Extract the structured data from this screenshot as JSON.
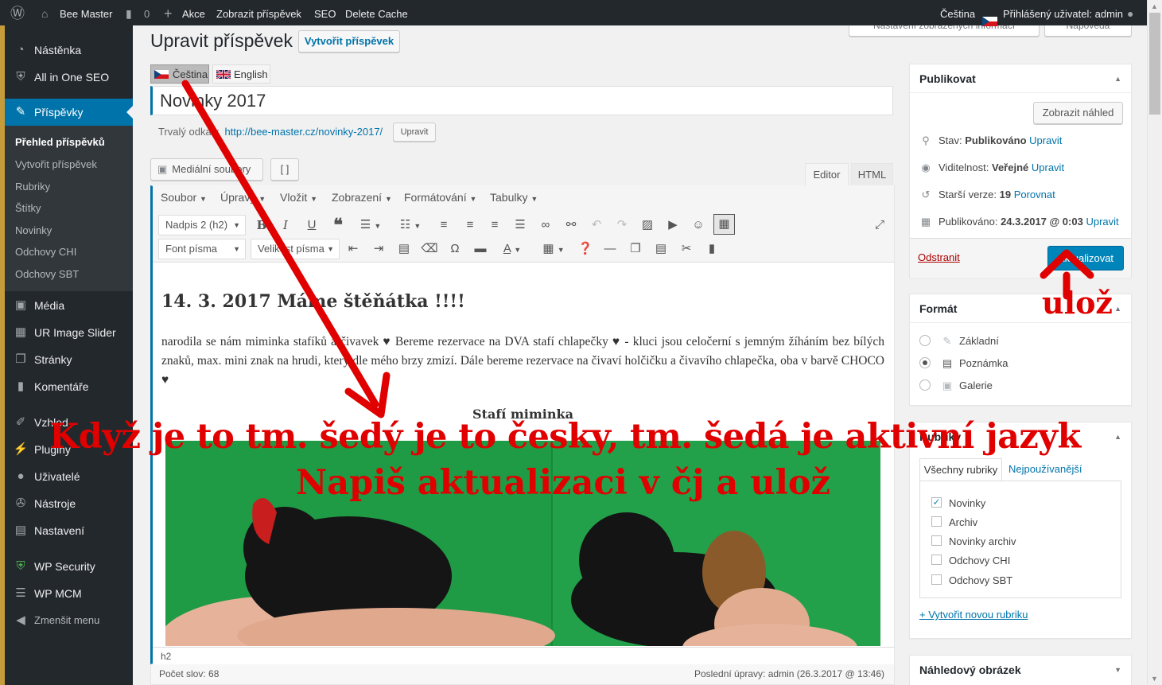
{
  "admin_bar": {
    "site_name": "Bee Master",
    "comments_count": "0",
    "new_label": "Akce",
    "view_post": "Zobrazit příspěvek",
    "seo": "SEO",
    "delete_cache": "Delete Cache",
    "language": "Čeština",
    "greeting": "Přihlášený uživatel: admin"
  },
  "sidebar": {
    "items": [
      {
        "label": "Nástěnka",
        "icon": "dashboard-icon"
      },
      {
        "label": "All in One SEO",
        "icon": "shield-icon"
      },
      {
        "label": "Příspěvky",
        "icon": "pin-icon"
      },
      {
        "label": "Média",
        "icon": "media-icon"
      },
      {
        "label": "UR Image Slider",
        "icon": "slider-icon"
      },
      {
        "label": "Stránky",
        "icon": "pages-icon"
      },
      {
        "label": "Komentáře",
        "icon": "comments-icon"
      },
      {
        "label": "Vzhled",
        "icon": "brush-icon"
      },
      {
        "label": "Pluginy",
        "icon": "plugin-icon"
      },
      {
        "label": "Uživatelé",
        "icon": "users-icon"
      },
      {
        "label": "Nástroje",
        "icon": "tools-icon"
      },
      {
        "label": "Nastavení",
        "icon": "settings-icon"
      },
      {
        "label": "WP Security",
        "icon": "security-icon"
      },
      {
        "label": "WP MCM",
        "icon": "mcm-icon"
      },
      {
        "label": "Zmenšit menu",
        "icon": "collapse-icon"
      }
    ],
    "submenu": [
      "Přehled příspěvků",
      "Vytvořit příspěvek",
      "Rubriky",
      "Štítky",
      "Novinky",
      "Odchovy CHI",
      "Odchovy SBT"
    ]
  },
  "screen_options": "Nastavení zobrazených informací",
  "help": "Nápověda",
  "page_title": "Upravit příspěvek",
  "add_new": "Vytvořit příspěvek",
  "lang_tabs": [
    "Čeština",
    "English"
  ],
  "post_title": "Novinky 2017",
  "permalink": {
    "label": "Trvalý odkaz:",
    "url": "http://bee-master.cz/novinky-2017/",
    "edit": "Upravit"
  },
  "media_button": "Mediální soubory",
  "shortcode_button": "[ ]",
  "editor_tabs": {
    "visual": "Editor",
    "html": "HTML"
  },
  "menubar": [
    "Soubor",
    "Úpravy",
    "Vložit",
    "Zobrazení",
    "Formátování",
    "Tabulky"
  ],
  "toolbar": {
    "format": "Nadpis 2 (h2)",
    "font_family": "Font písma",
    "font_size": "Velikost písma"
  },
  "content": {
    "heading": "14. 3. 2017 Máme štěňátka !!!!",
    "paragraph": "narodila se nám miminka stafíků a čivavek ♥  Bereme rezervace na DVA stafí chlapečky ♥ - kluci jsou celočerní s jemným žíháním bez bílých znaků, max. mini znak na hrudi, který dle mého brzy zmizí. Dále bereme rezervace na čivaví holčičku a čivavího chlapečka, oba v barvě CHOCO ♥",
    "caption": "Stafí miminka"
  },
  "status_path": "h2",
  "word_count": "Počet slov: 68",
  "last_edit": "Poslední úpravy: admin (26.3.2017 @ 13:46)",
  "publish": {
    "title": "Publikovat",
    "preview": "Zobrazit náhled",
    "status_label": "Stav:",
    "status_value": "Publikováno",
    "visibility_label": "Viditelnost:",
    "visibility_value": "Veřejné",
    "revisions_label": "Starší verze:",
    "revisions_value": "19",
    "revisions_link": "Porovnat",
    "published_label": "Publikováno:",
    "published_value": "24.3.2017 @ 0:03",
    "edit_link": "Upravit",
    "trash": "Odstranit",
    "update": "Aktualizovat"
  },
  "format_box": {
    "title": "Formát",
    "options": [
      "Základní",
      "Poznámka",
      "Galerie"
    ],
    "selected": "Poznámka"
  },
  "categories_box": {
    "title": "Rubriky",
    "tab_all": "Všechny rubriky",
    "tab_popular": "Nejpoužívanější",
    "items": [
      {
        "label": "Novinky",
        "checked": true
      },
      {
        "label": "Archiv",
        "checked": false
      },
      {
        "label": "Novinky archiv",
        "checked": false
      },
      {
        "label": "Odchovy CHI",
        "checked": false
      },
      {
        "label": "Odchovy SBT",
        "checked": false
      }
    ],
    "add_new": "+ Vytvořit novou rubriku"
  },
  "featured_image_title": "Náhledový obrázek",
  "annotations": {
    "save_short": "ulož",
    "line1": "Když je to tm. šedý je to česky, tm. šedá je aktivní jazyk",
    "line2": "Napiš aktualizaci v čj a ulož"
  },
  "colors": {
    "admin_bar": "#23282d",
    "menu_active": "#0073aa",
    "primary_button": "#0085ba",
    "annotation": "#e10000",
    "photo_bg": "#1f9a45"
  }
}
